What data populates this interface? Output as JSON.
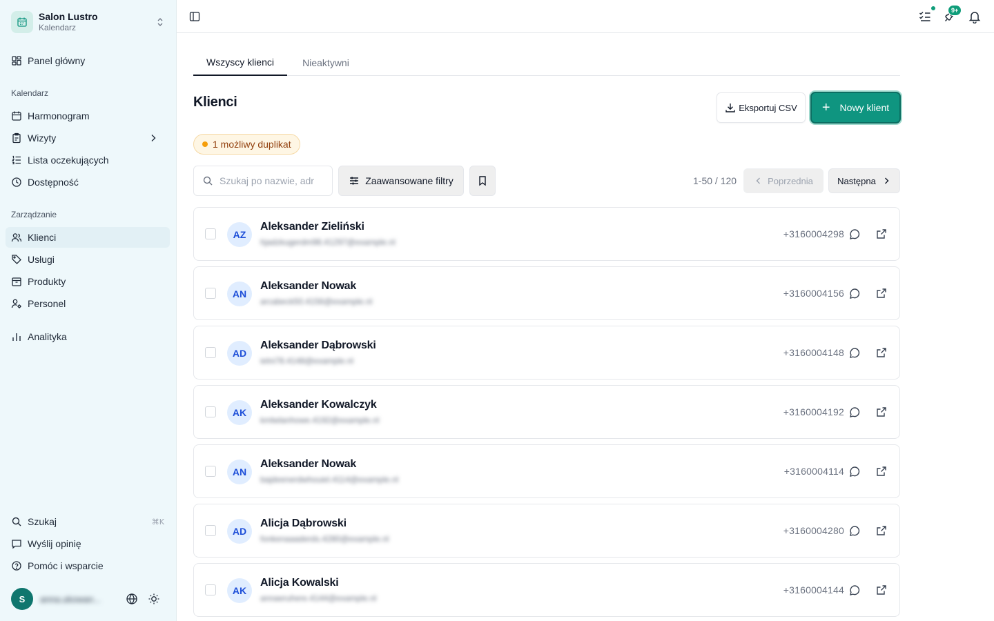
{
  "brand": {
    "name": "Salon Lustro",
    "subtitle": "Kalendarz"
  },
  "nav": {
    "dashboard": "Panel główny",
    "section_calendar": "Kalendarz",
    "schedule": "Harmonogram",
    "visits": "Wizyty",
    "waitlist": "Lista oczekujących",
    "availability": "Dostępność",
    "section_management": "Zarządzanie",
    "clients": "Klienci",
    "services": "Usługi",
    "products": "Produkty",
    "staff": "Personel",
    "analytics": "Analityka",
    "search": "Szukaj",
    "search_shortcut": "⌘K",
    "feedback": "Wyślij opinię",
    "help": "Pomóc i wsparcie"
  },
  "user": {
    "initial": "S",
    "name": "anna.ukowan..."
  },
  "topbar": {
    "notifications_badge": "9+"
  },
  "tabs": {
    "all": "Wszyscy klienci",
    "inactive": "Nieaktywni"
  },
  "header": {
    "title": "Klienci",
    "export_label": "Eksportuj CSV",
    "new_label": "Nowy klient"
  },
  "duplicate_badge": "1 możliwy duplikat",
  "toolbar": {
    "search_placeholder": "Szukaj po nazwie, adr",
    "filters_label": "Zaawansowane filtry",
    "page_count": "1-50 / 120",
    "prev_label": "Poprzednia",
    "next_label": "Następna"
  },
  "clients": [
    {
      "initials": "AZ",
      "name": "Aleksander Zieliński",
      "email": "hjadzkugerdm98.41297@example.nl",
      "phone": "+3160004298"
    },
    {
      "initials": "AN",
      "name": "Aleksander Nowak",
      "email": "arcabeck50.4156@example.nl",
      "phone": "+3160004156"
    },
    {
      "initials": "AD",
      "name": "Aleksander Dąbrowski",
      "email": "ielni78.4148@example.nl",
      "phone": "+3160004148"
    },
    {
      "initials": "AK",
      "name": "Aleksander Kowalczyk",
      "email": "kmlwlanhowe.4192@example.nl",
      "phone": "+3160004192"
    },
    {
      "initials": "AN",
      "name": "Aleksander Nowak",
      "email": "bajdeenerdwhouiel.4114@example.nl",
      "phone": "+3160004114"
    },
    {
      "initials": "AD",
      "name": "Alicja Dąbrowski",
      "email": "fonkenaaaderds.4280@example.nl",
      "phone": "+3160004280"
    },
    {
      "initials": "AK",
      "name": "Alicja Kowalski",
      "email": "annaeruhere.4144@example.nl",
      "phone": "+3160004144"
    }
  ],
  "colors": {
    "accent": "#0f9580",
    "sidebar_bg": "#eef8fb",
    "avatar_bg": "#e0edff",
    "avatar_text": "#1d4ed8",
    "warning": "#f59e0b"
  }
}
